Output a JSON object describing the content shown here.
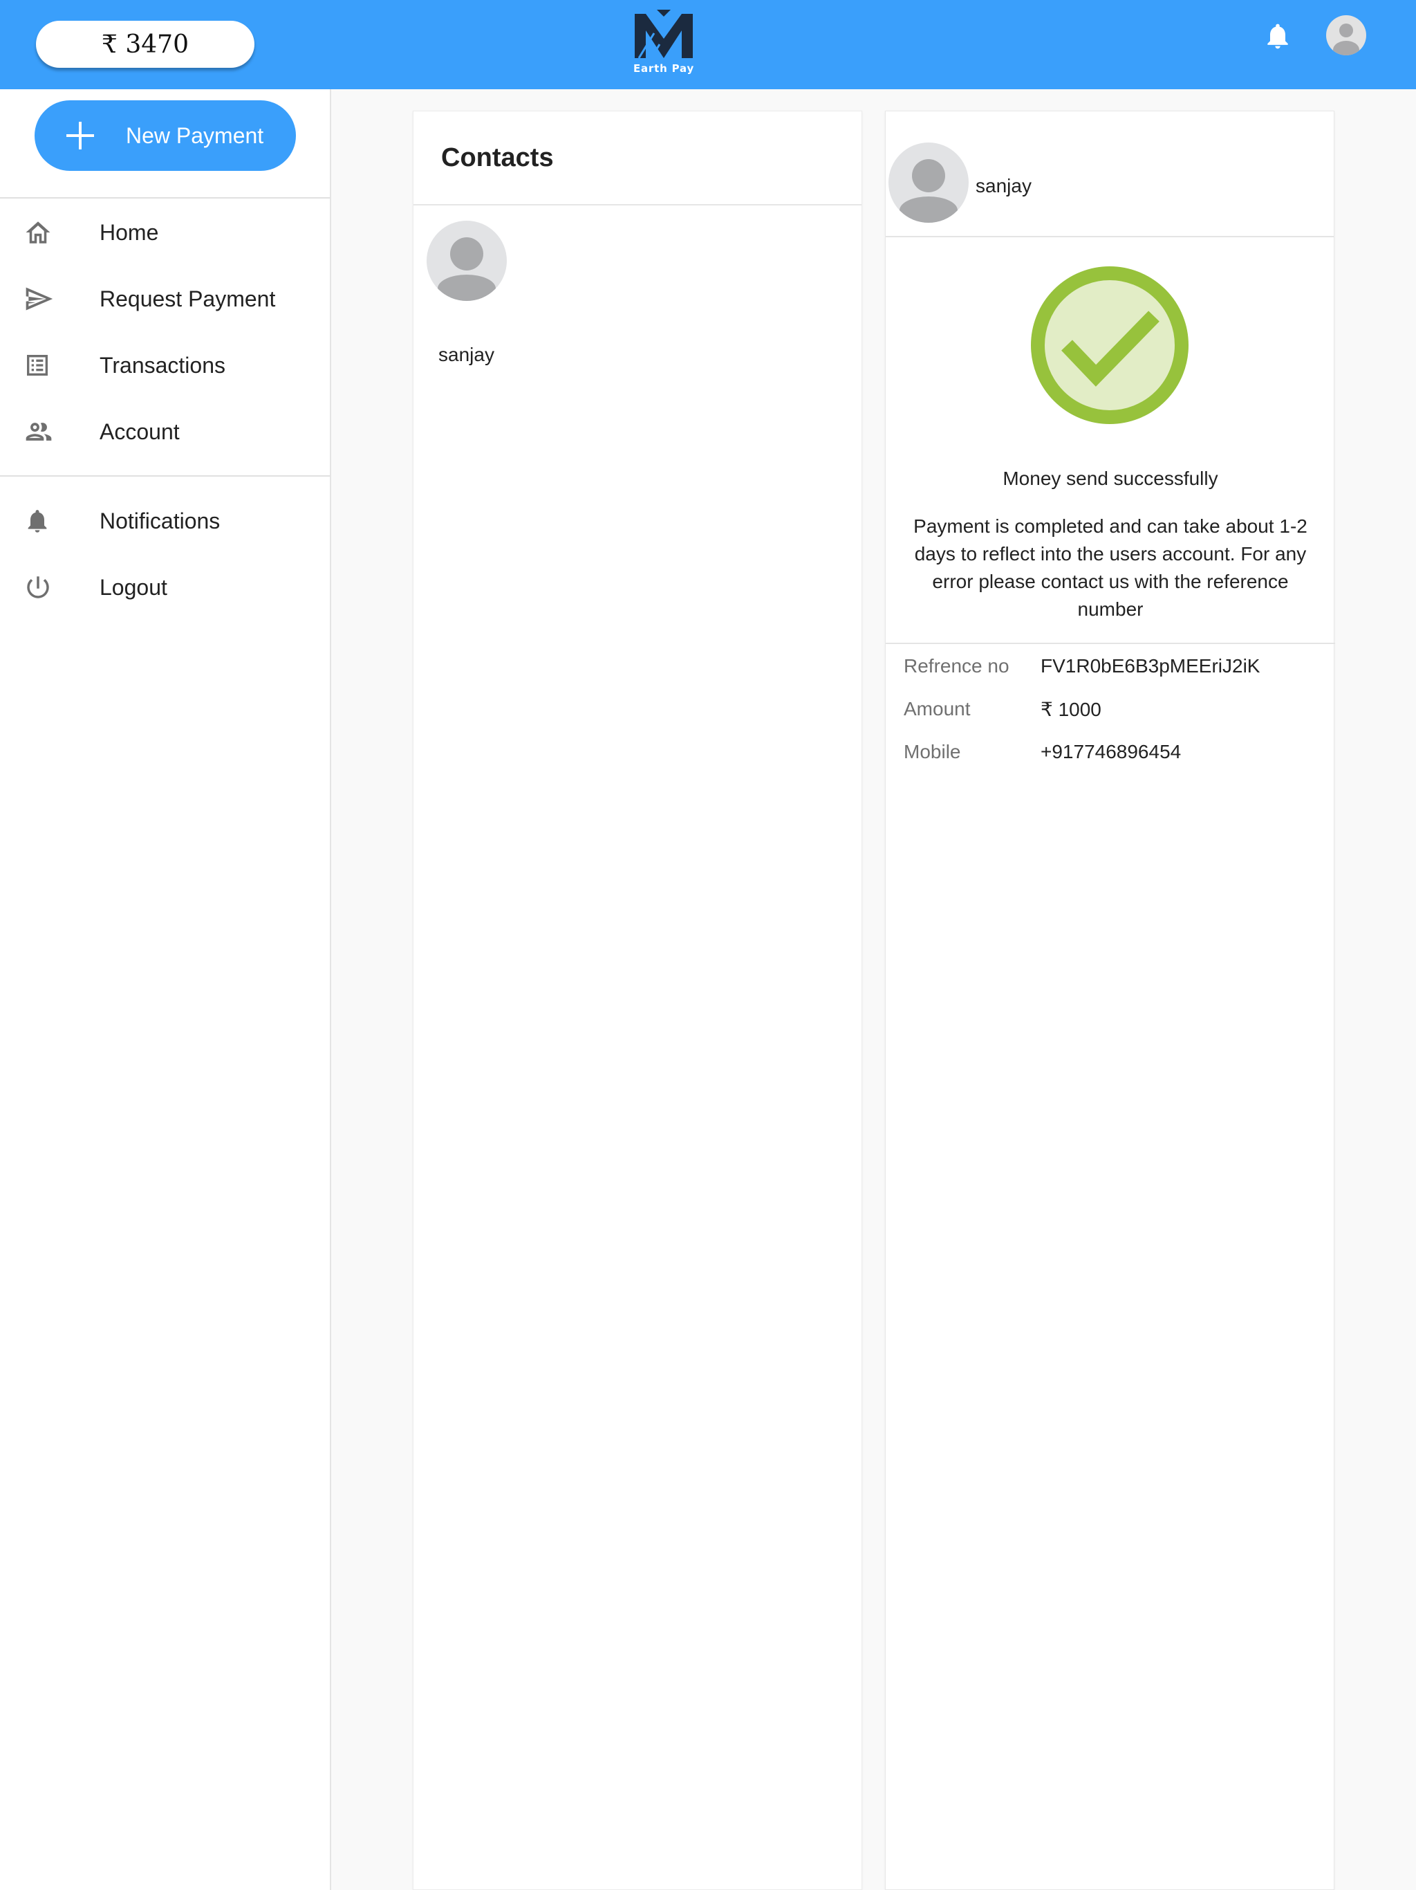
{
  "header": {
    "balance": "₹ 3470",
    "logo_text": "Earth Pay",
    "notifications_icon": "bell-icon",
    "profile_icon": "user-avatar-icon",
    "bar_color": "#3a9ffb"
  },
  "sidebar": {
    "new_payment_label": "New Payment",
    "items": [
      {
        "label": "Home",
        "icon": "home-icon"
      },
      {
        "label": "Request Payment",
        "icon": "send-icon"
      },
      {
        "label": "Transactions",
        "icon": "list-icon"
      },
      {
        "label": "Account",
        "icon": "people-icon"
      },
      {
        "label": "Notifications",
        "icon": "bell-icon"
      },
      {
        "label": "Logout",
        "icon": "power-icon"
      }
    ]
  },
  "contacts": {
    "title": "Contacts",
    "items": [
      {
        "name": "sanjay"
      }
    ]
  },
  "receipt": {
    "contact_name": "sanjay",
    "status": "Money send successfully",
    "description": "Payment is completed and can take about 1-2 days to reflect into the users account. For any error please contact us with the reference number",
    "details": [
      {
        "label": "Refrence no",
        "value": "FV1R0bE6B3pMEEriJ2iK"
      },
      {
        "label": "Amount",
        "value": "₹ 1000"
      },
      {
        "label": "Mobile",
        "value": "+917746896454"
      }
    ],
    "success_color": "#97c23c"
  }
}
